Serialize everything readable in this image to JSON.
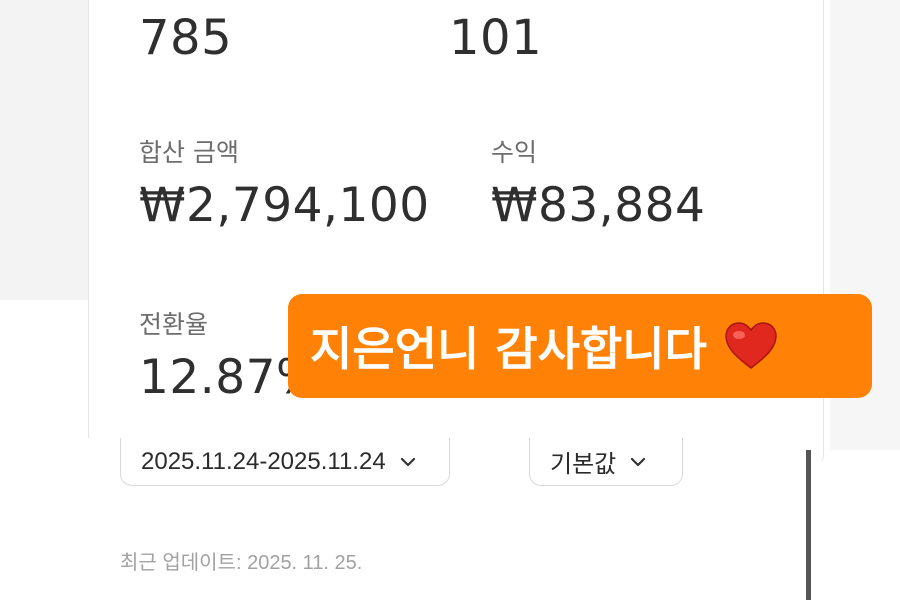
{
  "stats": {
    "top_left_value": "785",
    "top_right_value": "101",
    "total_amount_label": "합산 금액",
    "total_amount_value": "₩2,794,100",
    "profit_label": "수익",
    "profit_value": "₩83,884",
    "conversion_label": "전환율",
    "conversion_value": "12.87%"
  },
  "filters": {
    "date_range": "2025.11.24-2025.11.24",
    "sort": "기본값"
  },
  "footer": {
    "last_updated": "최근 업데이트: 2025. 11. 25."
  },
  "overlay": {
    "message": "지은언니 감사합니다",
    "emoji": "heart-icon",
    "background": "#ff8206"
  }
}
